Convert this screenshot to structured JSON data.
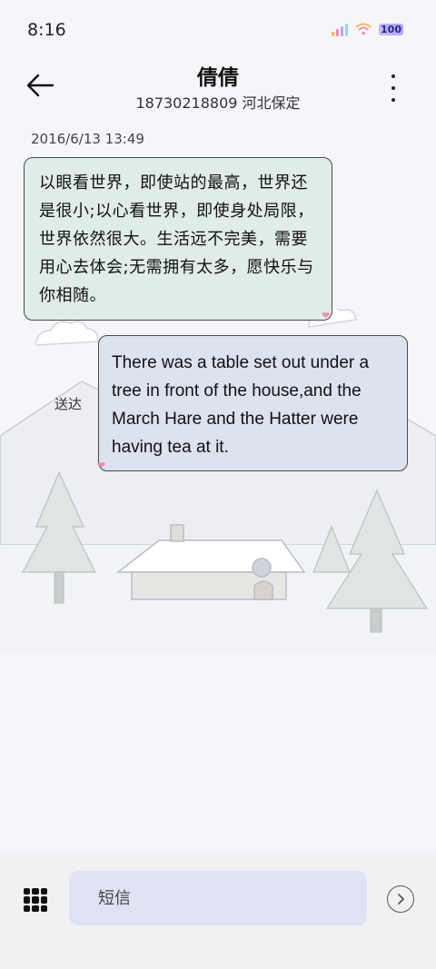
{
  "status_bar": {
    "time": "8:16",
    "battery": "100"
  },
  "header": {
    "title": "倩倩",
    "subtitle": "18730218809 河北保定"
  },
  "conversation": {
    "timestamp": "2016/6/13 13:49",
    "messages": [
      {
        "text": "以眼看世界，即使站的最高，世界还是很小;以心看世界，即使身处局限，世界依然很大。生活远不完美，需要用心去体会;无需拥有太多，愿快乐与你相随。"
      },
      {
        "text": "There was a table set out under a tree in front of the house,and the March Hare and the Hatter were having tea at it."
      }
    ],
    "status": "送达"
  },
  "composer": {
    "placeholder": "短信"
  },
  "colors": {
    "bubble_in": "#dfece8",
    "bubble_out": "#dde2ef",
    "input_bg": "#dfe2f2"
  }
}
